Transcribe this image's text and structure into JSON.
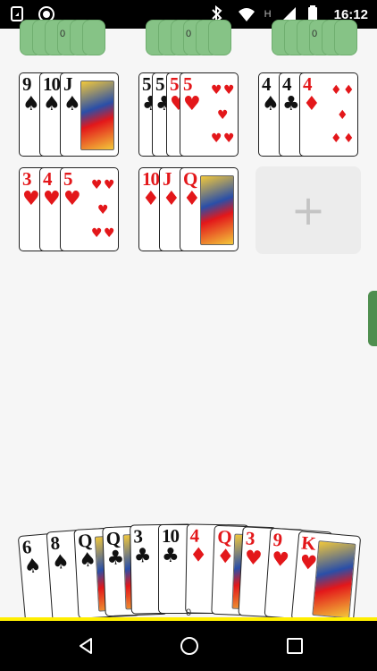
{
  "status_bar": {
    "time": "16:12",
    "icons": [
      "notification-icon",
      "target-icon",
      "bluetooth-icon",
      "wifi-icon",
      "h-signal-icon",
      "signal-icon",
      "battery-icon"
    ],
    "network_label": "H"
  },
  "opponents": [
    {
      "count": "0"
    },
    {
      "count": "0"
    },
    {
      "count": "0"
    }
  ],
  "melds": [
    {
      "cards": [
        {
          "rank": "9",
          "suit": "♠"
        },
        {
          "rank": "10",
          "suit": "♠"
        },
        {
          "rank": "J",
          "suit": "♠",
          "face": true
        }
      ]
    },
    {
      "cards": [
        {
          "rank": "5",
          "suit": "♣"
        },
        {
          "rank": "5",
          "suit": "♣"
        },
        {
          "rank": "5",
          "suit": "♥"
        },
        {
          "rank": "5",
          "suit": "♥"
        }
      ]
    },
    {
      "cards": [
        {
          "rank": "4",
          "suit": "♠"
        },
        {
          "rank": "4",
          "suit": "♣"
        },
        {
          "rank": "4",
          "suit": "♦"
        }
      ]
    },
    {
      "cards": [
        {
          "rank": "3",
          "suit": "♥"
        },
        {
          "rank": "4",
          "suit": "♥"
        },
        {
          "rank": "5",
          "suit": "♥"
        }
      ]
    },
    {
      "cards": [
        {
          "rank": "10",
          "suit": "♦"
        },
        {
          "rank": "J",
          "suit": "♦"
        },
        {
          "rank": "Q",
          "suit": "♦",
          "face": true
        }
      ]
    }
  ],
  "add_meld": {
    "label": "+"
  },
  "hand": {
    "count": "0",
    "cards": [
      {
        "rank": "6",
        "suit": "♠"
      },
      {
        "rank": "8",
        "suit": "♠"
      },
      {
        "rank": "Q",
        "suit": "♠",
        "face": true
      },
      {
        "rank": "Q",
        "suit": "♣",
        "face": true
      },
      {
        "rank": "3",
        "suit": "♣"
      },
      {
        "rank": "10",
        "suit": "♣"
      },
      {
        "rank": "4",
        "suit": "♦"
      },
      {
        "rank": "Q",
        "suit": "♦",
        "face": true
      },
      {
        "rank": "3",
        "suit": "♥"
      },
      {
        "rank": "9",
        "suit": "♥"
      },
      {
        "rank": "K",
        "suit": "♥",
        "face": true
      }
    ]
  },
  "colors": {
    "red_suit": "#e3171a",
    "black_suit": "#111111",
    "opponent_card": "#86c386",
    "accent_line": "#ffee00"
  }
}
